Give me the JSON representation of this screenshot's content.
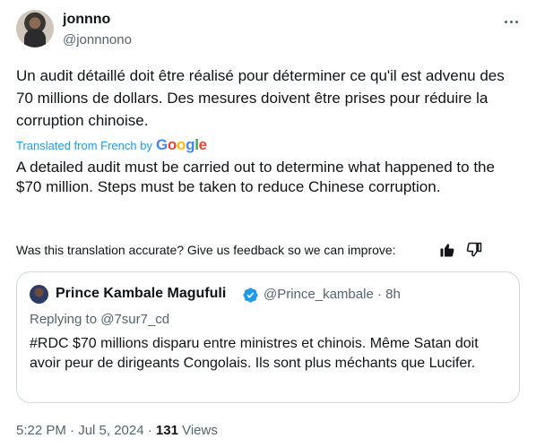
{
  "author": {
    "display_name": "jonnno",
    "handle": "@jonnnono"
  },
  "more_icon": "ellipsis-horizontal-icon",
  "original_text": "Un audit détaillé doit être réalisé pour déterminer ce qu'il est advenu des 70 millions de dollars. Des mesures doivent être prises pour réduire la corruption chinoise.",
  "translated_from": "Translated from French by",
  "google": {
    "g1": "G",
    "o1": "o",
    "o2": "o",
    "g2": "g",
    "l": "l",
    "e": "e"
  },
  "translation": "A detailed audit must be carried out to determine what happened to the $70 million. Steps must be taken to reduce Chinese corruption.",
  "feedback_text": "Was this translation accurate? Give us feedback so we can improve:",
  "feedback_icons": [
    "thumbs-up-icon",
    "thumbs-down-icon"
  ],
  "quote": {
    "display_name": "Prince Kambale Magufuli",
    "handle_time": "@Prince_kambale · 8h",
    "replying_prefix": "Replying to ",
    "replying_to": "@7sur7_cd",
    "text": "#RDC $70 millions disparu entre ministres et chinois. Même Satan doit avoir peur de dirigeants Congolais.  Ils sont plus méchants que Lucifer.",
    "verified_color": "#1d9bf0"
  },
  "meta": {
    "time_date": "5:22 PM · Jul 5, 2024 · ",
    "views_count": "131",
    "views_label": " Views"
  },
  "colors": {
    "text_primary": "#0f1419",
    "text_secondary": "#536471",
    "link": "#1d9bf0",
    "border": "#cfd9de"
  }
}
